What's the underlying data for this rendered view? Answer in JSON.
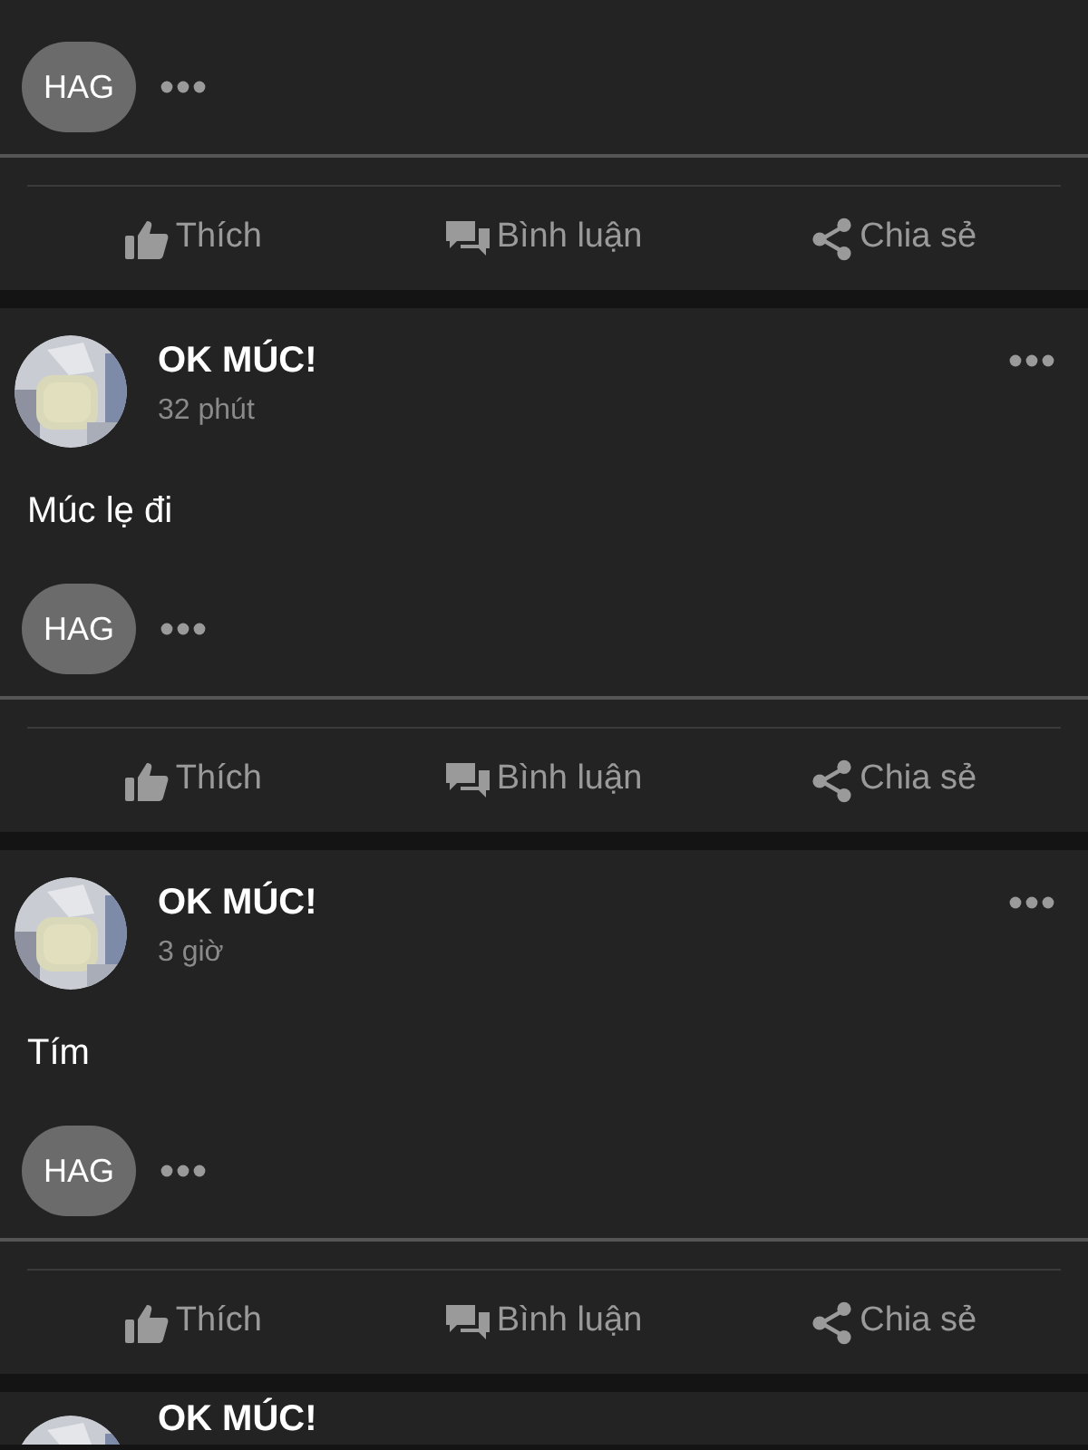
{
  "posts": [
    {
      "reaction_chip": "HAG",
      "actions": [
        {
          "kind": "like",
          "label": "Thích"
        },
        {
          "kind": "comment",
          "label": "Bình luận"
        },
        {
          "kind": "share",
          "label": "Chia sẻ"
        }
      ]
    },
    {
      "author": "OK MÚC!",
      "time": "32 phút",
      "text": "Múc lẹ đi",
      "reaction_chip": "HAG",
      "actions": [
        {
          "kind": "like",
          "label": "Thích"
        },
        {
          "kind": "comment",
          "label": "Bình luận"
        },
        {
          "kind": "share",
          "label": "Chia sẻ"
        }
      ]
    },
    {
      "author": "OK MÚC!",
      "time": "3 giờ",
      "text": "Tím",
      "reaction_chip": "HAG",
      "actions": [
        {
          "kind": "like",
          "label": "Thích"
        },
        {
          "kind": "comment",
          "label": "Bình luận"
        },
        {
          "kind": "share",
          "label": "Chia sẻ"
        }
      ]
    },
    {
      "author": "OK MÚC!"
    }
  ]
}
